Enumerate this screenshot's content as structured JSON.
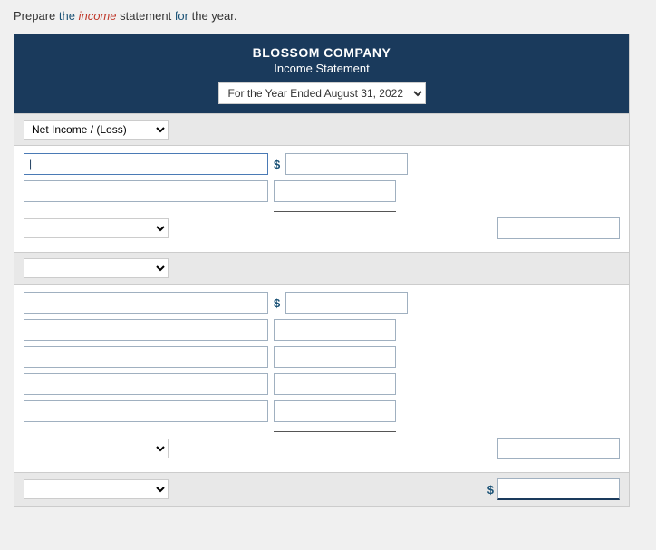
{
  "instruction": {
    "text": "Prepare the income statement for the year.",
    "words": [
      "Prepare",
      "the",
      "income",
      "statement",
      "for",
      "the",
      "year."
    ]
  },
  "header": {
    "company": "BLOSSOM COMPANY",
    "title": "Income Statement",
    "period_label": "For the Year Ended August 31, 2022",
    "period_options": [
      "For the Year Ended August 31, 2022"
    ]
  },
  "section1": {
    "label": "Net Income / (Loss)",
    "dropdown_options": [
      "Net Income / (Loss)"
    ]
  },
  "section2": {
    "label": "",
    "dropdown_options": [
      ""
    ]
  },
  "bottom": {
    "label": "",
    "dollar_sign": "$"
  },
  "dollar_sign": "$"
}
